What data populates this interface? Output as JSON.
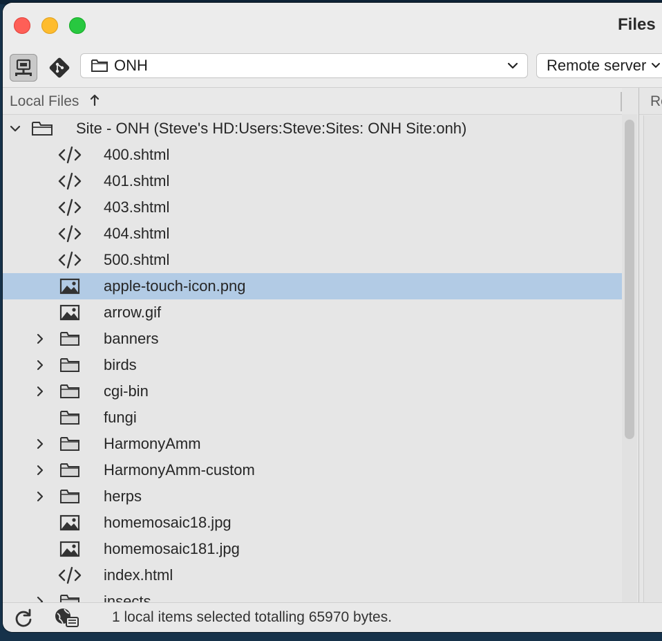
{
  "window": {
    "title": "Files"
  },
  "toolbar": {
    "connect_icon": "connect-icon",
    "git_icon": "git-icon",
    "site_select": {
      "value": "ONH"
    },
    "server_select": {
      "value": "Remote server"
    }
  },
  "local_pane": {
    "header": "Local Files",
    "tree": [
      {
        "name": "Site - ONH (Steve's HD:Users:Steve:Sites: ONH Site:onh)",
        "type": "root",
        "expanded": true
      },
      {
        "name": "400.shtml",
        "type": "code"
      },
      {
        "name": "401.shtml",
        "type": "code"
      },
      {
        "name": "403.shtml",
        "type": "code"
      },
      {
        "name": "404.shtml",
        "type": "code"
      },
      {
        "name": "500.shtml",
        "type": "code"
      },
      {
        "name": "apple-touch-icon.png",
        "type": "image",
        "selected": true
      },
      {
        "name": "arrow.gif",
        "type": "image"
      },
      {
        "name": "banners",
        "type": "folder",
        "expandable": true
      },
      {
        "name": "birds",
        "type": "folder",
        "expandable": true
      },
      {
        "name": "cgi-bin",
        "type": "folder",
        "expandable": true
      },
      {
        "name": "fungi",
        "type": "folder",
        "expandable": false
      },
      {
        "name": "HarmonyAmm",
        "type": "folder",
        "expandable": true
      },
      {
        "name": "HarmonyAmm-custom",
        "type": "folder",
        "expandable": true
      },
      {
        "name": "herps",
        "type": "folder",
        "expandable": true
      },
      {
        "name": "homemosaic18.jpg",
        "type": "image"
      },
      {
        "name": "homemosaic181.jpg",
        "type": "image"
      },
      {
        "name": "index.html",
        "type": "code"
      },
      {
        "name": "insects",
        "type": "folder",
        "expandable": true
      }
    ]
  },
  "remote_pane": {
    "header": "Re"
  },
  "status_bar": {
    "text": "1 local items selected totalling 65970 bytes.",
    "refresh_icon": "refresh-icon",
    "log_icon": "globe-log-icon"
  },
  "colors": {
    "selection": "#b2cbe5",
    "close": "#fe5f57",
    "minimize": "#febc2e",
    "maximize": "#28c840"
  }
}
